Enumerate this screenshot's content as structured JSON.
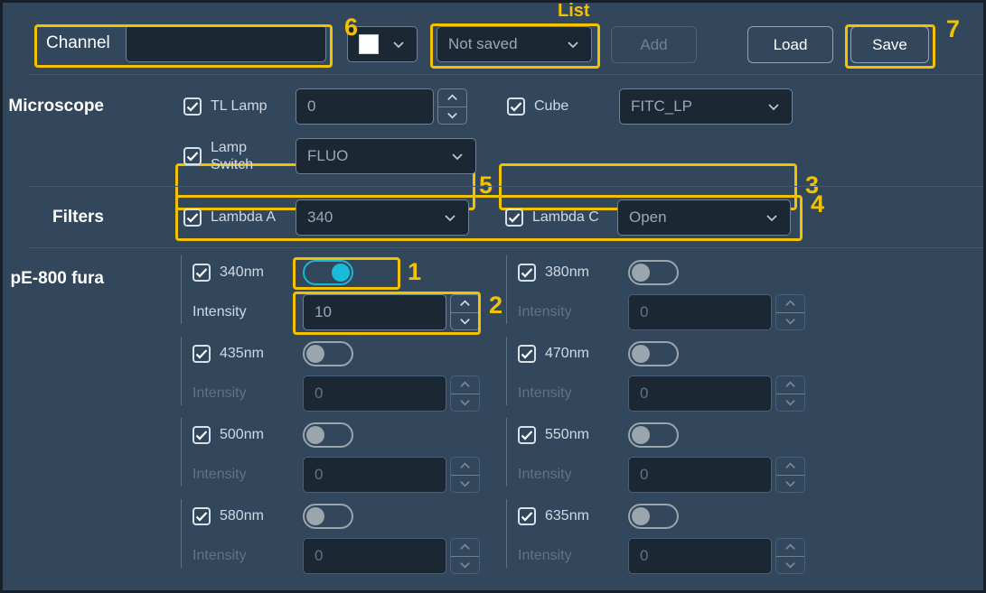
{
  "header": {
    "channel_label": "Channel",
    "channel_value": "",
    "channel_placeholder": "",
    "color_swatch": "#ffffff",
    "list_annotation": "List",
    "list_value": "Not saved",
    "add_label": "Add",
    "load_label": "Load",
    "save_label": "Save"
  },
  "microscope": {
    "section_label": "Microscope",
    "tl_lamp": {
      "label": "TL Lamp",
      "checked": true,
      "value": "0"
    },
    "lamp_switch": {
      "label": "Lamp\nSwitch",
      "label_line1": "Lamp",
      "label_line2": "Switch",
      "checked": true,
      "value": "FLUO"
    },
    "cube": {
      "label": "Cube",
      "checked": true,
      "value": "FITC_LP"
    }
  },
  "filters": {
    "section_label": "Filters",
    "lambda_a": {
      "label": "Lambda A",
      "checked": true,
      "value": "340"
    },
    "lambda_c": {
      "label": "Lambda C",
      "checked": true,
      "value": "Open"
    }
  },
  "light_source": {
    "section_label": "pE-800 fura",
    "intensity_label": "Intensity",
    "channels": [
      {
        "label": "340nm",
        "checked": true,
        "on": true,
        "intensity": "10"
      },
      {
        "label": "380nm",
        "checked": true,
        "on": false,
        "intensity": "0"
      },
      {
        "label": "435nm",
        "checked": true,
        "on": false,
        "intensity": "0"
      },
      {
        "label": "470nm",
        "checked": true,
        "on": false,
        "intensity": "0"
      },
      {
        "label": "500nm",
        "checked": true,
        "on": false,
        "intensity": "0"
      },
      {
        "label": "550nm",
        "checked": true,
        "on": false,
        "intensity": "0"
      },
      {
        "label": "580nm",
        "checked": true,
        "on": false,
        "intensity": "0"
      },
      {
        "label": "635nm",
        "checked": true,
        "on": false,
        "intensity": "0"
      }
    ]
  },
  "annotations": {
    "a1": "1",
    "a2": "2",
    "a3": "3",
    "a4": "4",
    "a5": "5",
    "a6": "6",
    "a7": "7"
  },
  "colors": {
    "background": "#32475c",
    "field": "#1b2833",
    "highlight": "#f2c200",
    "toggle_on": "#19bcd8",
    "toggle_off": "#9aa5ad"
  }
}
